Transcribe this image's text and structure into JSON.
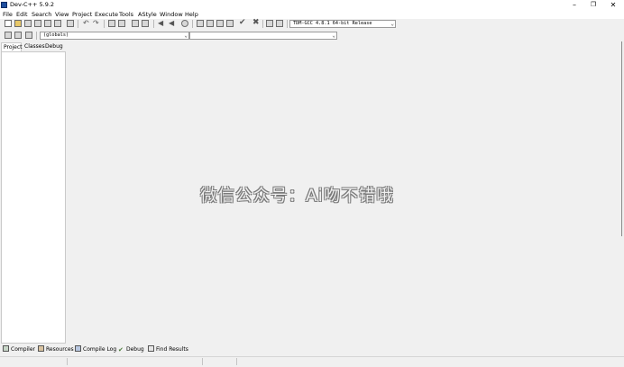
{
  "window": {
    "title": "Dev-C++ 5.9.2"
  },
  "menu": [
    "File",
    "Edit",
    "Search",
    "View",
    "Project",
    "Execute",
    "Tools",
    "AStyle",
    "Window",
    "Help"
  ],
  "toolbar": {
    "compiler_select": "TDM-GCC 4.8.1 64-bit Release"
  },
  "class_bar": {
    "scope_select": "(globals)",
    "member_select": ""
  },
  "side_tabs": [
    "Project",
    "Classes",
    "Debug"
  ],
  "editor": {
    "watermark": "微信公众号：Ai吻不错哦"
  },
  "bottom_tabs": [
    {
      "label": "Compiler",
      "icon": "compiler-icon"
    },
    {
      "label": "Resources",
      "icon": "resources-icon"
    },
    {
      "label": "Compile Log",
      "icon": "compile-log-icon"
    },
    {
      "label": "Debug",
      "icon": "debug-check-icon"
    },
    {
      "label": "Find Results",
      "icon": "find-results-icon"
    }
  ],
  "colors": {
    "app_icon": "#1f4f9e",
    "background": "#f0f0f0",
    "panel": "#ffffff"
  }
}
